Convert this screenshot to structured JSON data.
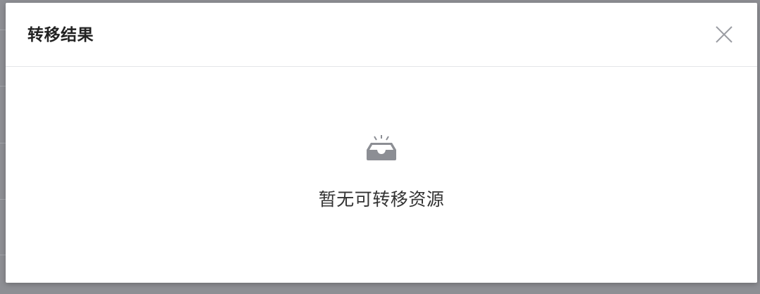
{
  "dialog": {
    "title": "转移结果",
    "close_icon": "close-icon",
    "empty": {
      "icon": "empty-inbox-icon",
      "text": "暂无可转移资源"
    }
  },
  "colors": {
    "overlay": "#8e8f94",
    "panel": "#ffffff",
    "divider": "#e4e5e8",
    "icon": "#8c8e94",
    "title": "#222222",
    "text": "#333333"
  }
}
